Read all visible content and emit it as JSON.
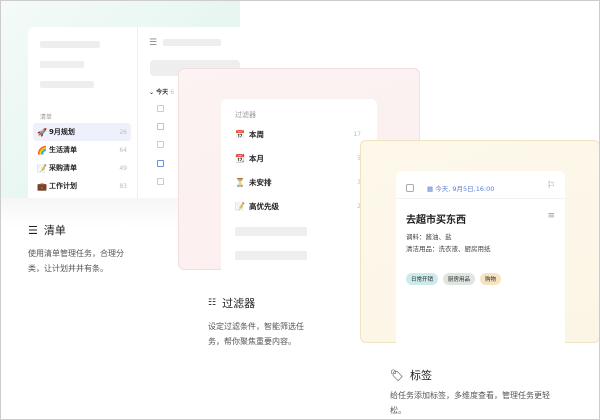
{
  "lists_panel": {
    "section_label": "清单",
    "items": [
      {
        "icon": "rocket-icon",
        "emoji": "🚀",
        "label": "9月规划",
        "count": "26"
      },
      {
        "icon": "rainbow-icon",
        "emoji": "🌈",
        "label": "生活清单",
        "count": "64"
      },
      {
        "icon": "memo-icon",
        "emoji": "📝",
        "label": "采购清单",
        "count": "49"
      },
      {
        "icon": "briefcase-icon",
        "emoji": "💼",
        "label": "工作计划",
        "count": "83"
      }
    ],
    "today_label": "今天",
    "today_count": "6"
  },
  "filters_panel": {
    "section_label": "过滤器",
    "items": [
      {
        "icon": "calendar-week-icon",
        "emoji": "📅",
        "label": "本周",
        "count": "17"
      },
      {
        "icon": "calendar-month-icon",
        "emoji": "📆",
        "label": "本月",
        "count": "5"
      },
      {
        "icon": "hourglass-icon",
        "emoji": "⏳",
        "label": "未安排",
        "count": "3"
      },
      {
        "icon": "memo-icon",
        "emoji": "📝",
        "label": "高优先级",
        "count": "2"
      }
    ]
  },
  "task_card": {
    "date": "今天, 9月5日,16:00",
    "title": "去超市买东西",
    "lines": [
      "调料：酱油、盐",
      "清洁用品：洗衣液、厨房用纸"
    ],
    "tags": [
      {
        "label": "日常开销",
        "color": "#cdeaec"
      },
      {
        "label": "厨房用品",
        "color": "#dfe6e1"
      },
      {
        "label": "购物",
        "color": "#f7e3c0"
      }
    ],
    "accent": "#5b7fd6"
  },
  "features": [
    {
      "title": "清单",
      "desc": [
        "使用清单管理任务，合理分",
        "类，让计划井井有条。"
      ]
    },
    {
      "title": "过滤器",
      "desc": [
        "设定过滤条件，智能筛选任",
        "务，帮你聚焦重要内容。"
      ]
    },
    {
      "title": "标签",
      "desc": [
        "给任务添加标签，多维度查看，管理任务更轻",
        "松。"
      ]
    }
  ]
}
